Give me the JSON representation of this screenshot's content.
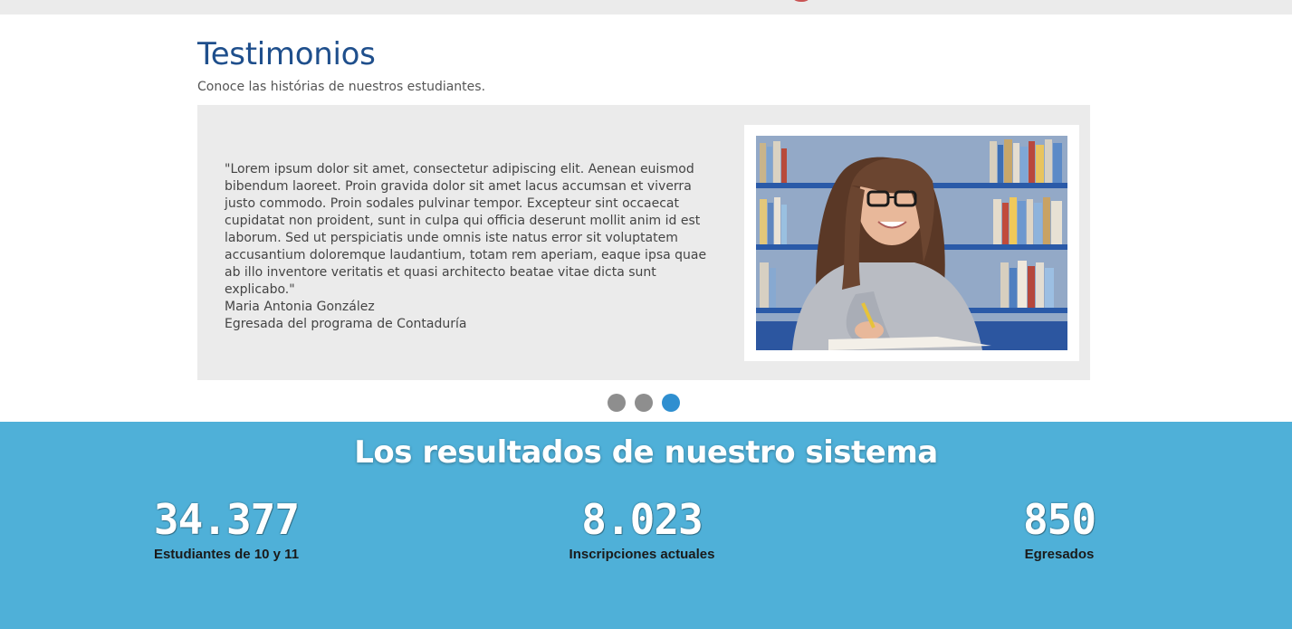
{
  "testimonials": {
    "title": "Testimonios",
    "subtitle": "Conoce las histórias de nuestros estudiantes.",
    "active_slide": 3,
    "slide_count": 3,
    "current": {
      "quote": "\"Lorem ipsum dolor sit amet, consectetur adipiscing elit. Aenean euismod bibendum laoreet. Proin gravida dolor sit amet lacus accumsan et viverra justo commodo. Proin sodales pulvinar tempor. Excepteur sint occaecat cupidatat non proident, sunt in culpa qui officia deserunt mollit anim id est laborum. Sed ut perspiciatis unde omnis iste natus error sit voluptatem accusantium doloremque laudantium, totam rem aperiam, eaque ipsa quae ab illo inventore veritatis et quasi architecto beatae vitae dicta sunt explicabo.\"",
      "author_name": "Maria Antonia González",
      "author_role": "Egresada del programa de Contaduría",
      "photo": "student-studying-photo"
    }
  },
  "results": {
    "title": "Los resultados de nuestro sistema",
    "stats": [
      {
        "value": "34.377",
        "label": "Estudiantes de 10 y 11"
      },
      {
        "value": "8.023",
        "label": "Inscripciones actuales"
      },
      {
        "value": "850",
        "label": "Egresados"
      }
    ]
  },
  "colors": {
    "title_blue": "#1f4f8c",
    "slide_bg": "#ebebeb",
    "dot_inactive": "#8e8e8e",
    "dot_active": "#2f8fd0",
    "results_bg": "#4fb0d8"
  }
}
